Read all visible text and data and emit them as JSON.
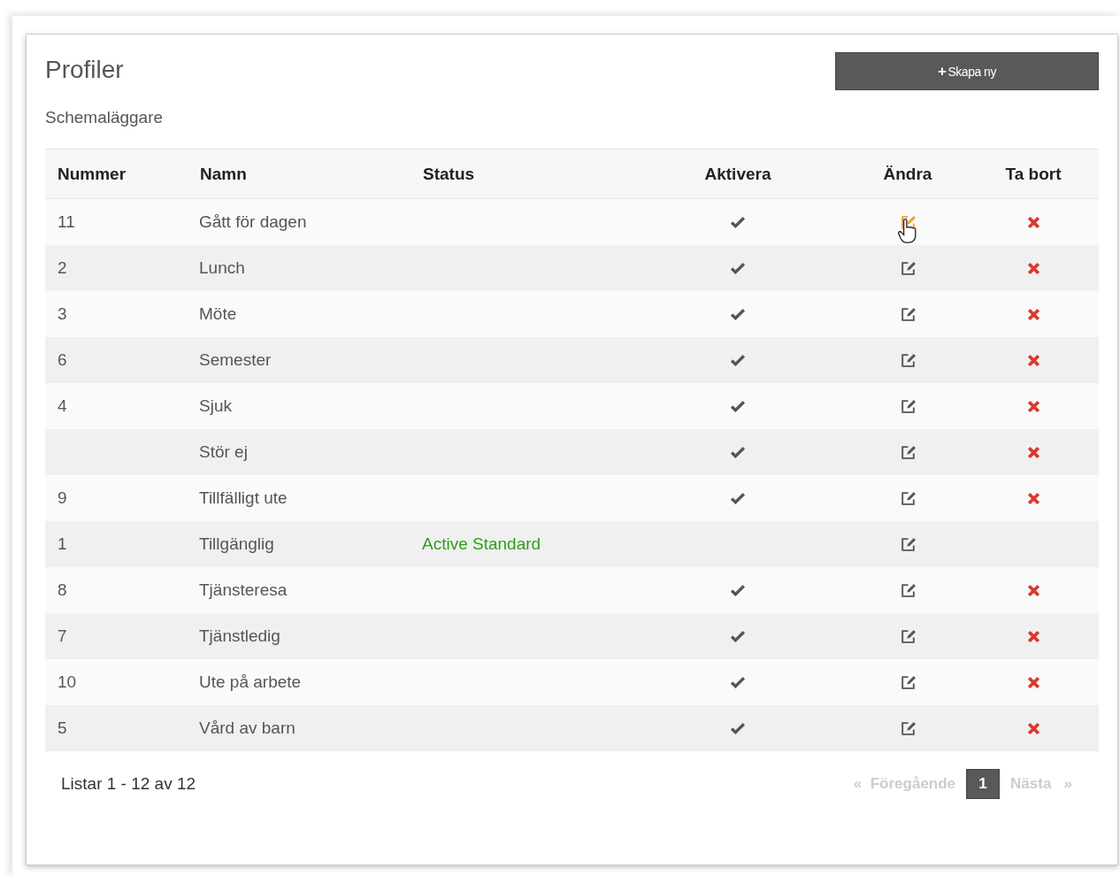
{
  "page": {
    "title": "Profiler",
    "subtitle": "Schemaläggare",
    "create_button": {
      "icon": "+",
      "label": "Skapa ny"
    }
  },
  "table": {
    "columns": [
      "Nummer",
      "Namn",
      "Status",
      "Aktivera",
      "Ändra",
      "Ta bort"
    ],
    "rows": [
      {
        "number": "11",
        "name": "Gått för dagen",
        "can_activate": true,
        "can_delete": true,
        "hovered": true
      },
      {
        "number": "2",
        "name": "Lunch",
        "can_activate": true,
        "can_delete": true,
        "hovered": false
      },
      {
        "number": "3",
        "name": "Möte",
        "can_activate": true,
        "can_delete": true,
        "hovered": false
      },
      {
        "number": "6",
        "name": "Semester",
        "can_activate": true,
        "can_delete": true,
        "hovered": false
      },
      {
        "number": "4",
        "name": "Sjuk",
        "can_activate": true,
        "can_delete": true,
        "hovered": false
      },
      {
        "name": "Stör ej",
        "can_activate": true,
        "can_delete": true,
        "hovered": false
      },
      {
        "number": "9",
        "name": "Tillfälligt ute",
        "can_activate": true,
        "can_delete": true,
        "hovered": false
      },
      {
        "number": "1",
        "name": "Tillgänglig",
        "status": "Active Standard",
        "can_activate": false,
        "can_delete": false,
        "hovered": false
      },
      {
        "number": "8",
        "name": "Tjänsteresa",
        "can_activate": true,
        "can_delete": true,
        "hovered": false
      },
      {
        "number": "7",
        "name": "Tjänstledig",
        "can_activate": true,
        "can_delete": true,
        "hovered": false
      },
      {
        "number": "10",
        "name": "Ute på arbete",
        "can_activate": true,
        "can_delete": true,
        "hovered": false
      },
      {
        "number": "5",
        "name": "Vård av barn",
        "can_activate": true,
        "can_delete": true,
        "hovered": false
      }
    ]
  },
  "footer": {
    "summary": "Listar 1 - 12 av 12",
    "pagination": {
      "previous": {
        "arrow": "«",
        "label": "Föregående",
        "disabled": true
      },
      "pages": [
        {
          "label": "1",
          "selected": true
        }
      ],
      "next": {
        "label": "Nästa",
        "arrow": "»",
        "disabled": true
      }
    }
  }
}
